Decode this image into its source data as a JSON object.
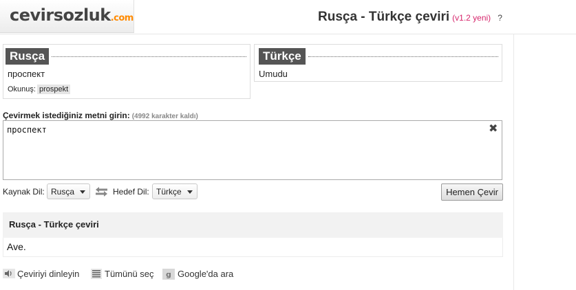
{
  "header": {
    "logo_main": "cevirsozluk",
    "logo_domain": ".com",
    "title": "Rusça - Türkçe çeviri",
    "version": "(v1.2 yeni)",
    "help": "?"
  },
  "source_box": {
    "lang": "Rusça",
    "word": "проспект",
    "pron_label": "Okunuş:",
    "pron_value": "prospekt"
  },
  "target_box": {
    "lang": "Türkçe",
    "word": "Umudu"
  },
  "input": {
    "prompt": "Çevirmek istediğiniz metni girin:",
    "chars_left": "(4992 karakter kaldı)",
    "value": "проспект",
    "clear_label": "✖"
  },
  "controls": {
    "source_label": "Kaynak Dil:",
    "source_value": "Rusça",
    "target_label": "Hedef Dil:",
    "target_value": "Türkçe",
    "swap_icon": "swap-arrows-icon",
    "translate_button": "Hemen Çevir"
  },
  "result": {
    "title": "Rusça - Türkçe çeviri",
    "text": "Ave."
  },
  "actions": {
    "listen": "Çeviriyi dinleyin",
    "select_all": "Tümünü seç",
    "google": "Google'da ara"
  },
  "colors": {
    "accent_version": "#d6256b",
    "logo_domain": "#ff8a00",
    "lang_tag_bg": "#555555"
  }
}
